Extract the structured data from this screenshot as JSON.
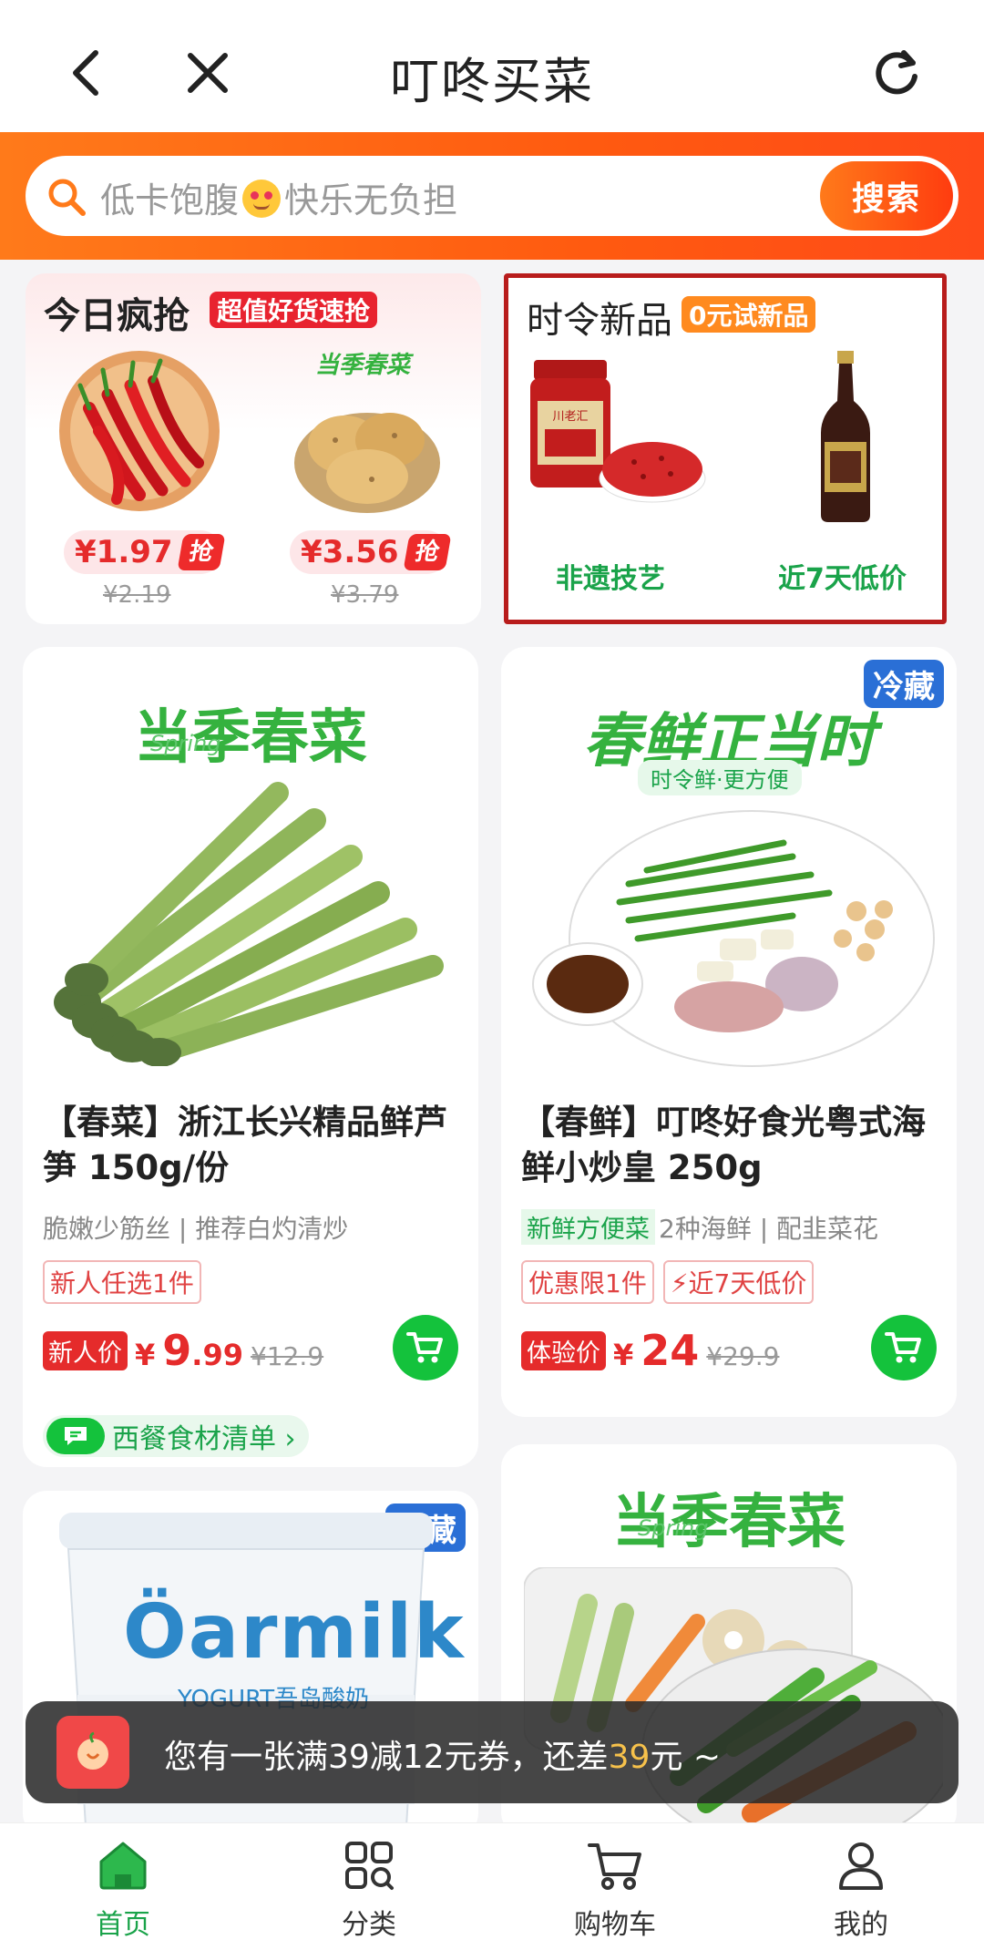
{
  "header": {
    "title": "叮咚买菜"
  },
  "search": {
    "placeholder_prefix": "低卡饱腹",
    "placeholder_suffix": "快乐无负担",
    "button": "搜索"
  },
  "promo_left": {
    "title": "今日疯抢",
    "badge": "超值好货速抢",
    "item1": {
      "price": "¥1.97",
      "grab": "抢",
      "original": "¥2.19"
    },
    "item2": {
      "tag": "当季春菜",
      "price": "¥3.56",
      "grab": "抢",
      "original": "¥3.79"
    }
  },
  "promo_right": {
    "title": "时令新品",
    "badge": "0元试新品",
    "jar_label": "川老汇",
    "sub1": "非遗技艺",
    "sub2": "近7天低价"
  },
  "products": [
    {
      "banner": "当季春菜",
      "banner_script": "Spring",
      "title": "【春菜】浙江长兴精品鲜芦笋 150g/份",
      "subtitle": "脆嫩少筋丝 | 推荐白灼清炒",
      "tags": [
        "新人任选1件"
      ],
      "price_label": "新人价",
      "price_int": "9",
      "price_dec": ".99",
      "price_old": "¥12.9",
      "list_link": "西餐食材清单 ›"
    },
    {
      "banner": "春鲜正当时",
      "banner_sub": "时令鲜·更方便",
      "cold_tag": "冷藏",
      "title": "【春鲜】叮咚好食光粤式海鲜小炒皇 250g",
      "subtitle_tag": "新鲜方便菜",
      "subtitle": "2种海鲜 | 配韭菜花",
      "tags": [
        "优惠限1件",
        "近7天低价"
      ],
      "price_label": "体验价",
      "price_int": "24",
      "price_old": "¥29.9"
    },
    {
      "cold_tag": "冷藏",
      "brand": "Öarmilk",
      "brand_sub": "YOGURT吾岛酸奶"
    },
    {
      "banner": "当季春菜",
      "banner_script": "Spring"
    }
  ],
  "toast": {
    "text_before": "您有一张满39减12元券，还差",
    "amount": "39",
    "text_after": "元 ~"
  },
  "tabbar": [
    {
      "label": "首页",
      "icon": "home-icon",
      "active": true
    },
    {
      "label": "分类",
      "icon": "category-icon",
      "active": false
    },
    {
      "label": "购物车",
      "icon": "cart-icon",
      "active": false
    },
    {
      "label": "我的",
      "icon": "profile-icon",
      "active": false
    }
  ],
  "colors": {
    "brand_orange": "#ff5a10",
    "accent_green": "#14c23c",
    "price_red": "#e52b2b",
    "cold_blue": "#2a6fd6"
  }
}
